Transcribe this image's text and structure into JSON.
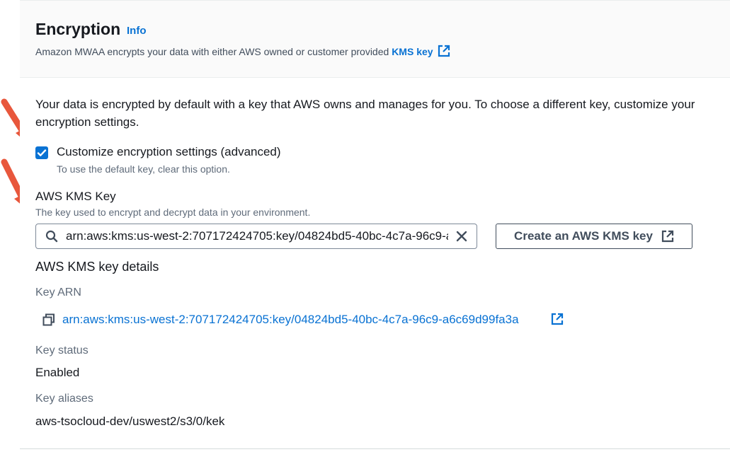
{
  "header": {
    "title": "Encryption",
    "info_label": "Info",
    "description_prefix": "Amazon MWAA encrypts your data with either AWS owned or customer provided ",
    "kms_link": "KMS key"
  },
  "intro_text": "Your data is encrypted by default with a key that AWS owns and manages for you. To choose a different key, customize your encryption settings.",
  "customize_checkbox": {
    "checked": true,
    "label": "Customize encryption settings (advanced)",
    "description": "To use the default key, clear this option."
  },
  "kms_key_field": {
    "label": "AWS KMS Key",
    "description": "The key used to encrypt and decrypt data in your environment.",
    "value": "arn:aws:kms:us-west-2:707172424705:key/04824bd5-40bc-4c7a-96c9-a6c69d99fa3a"
  },
  "create_button": {
    "label": "Create an AWS KMS key"
  },
  "details": {
    "title": "AWS KMS key details",
    "key_arn_label": "Key ARN",
    "key_arn_value": "arn:aws:kms:us-west-2:707172424705:key/04824bd5-40bc-4c7a-96c9-a6c69d99fa3a",
    "key_status_label": "Key status",
    "key_status_value": "Enabled",
    "key_aliases_label": "Key aliases",
    "key_aliases_value": "aws-tsocloud-dev/uswest2/s3/0/kek"
  },
  "colors": {
    "link": "#0972d3",
    "checkbox": "#0972d3",
    "annotation_arrow": "#e8573c"
  }
}
